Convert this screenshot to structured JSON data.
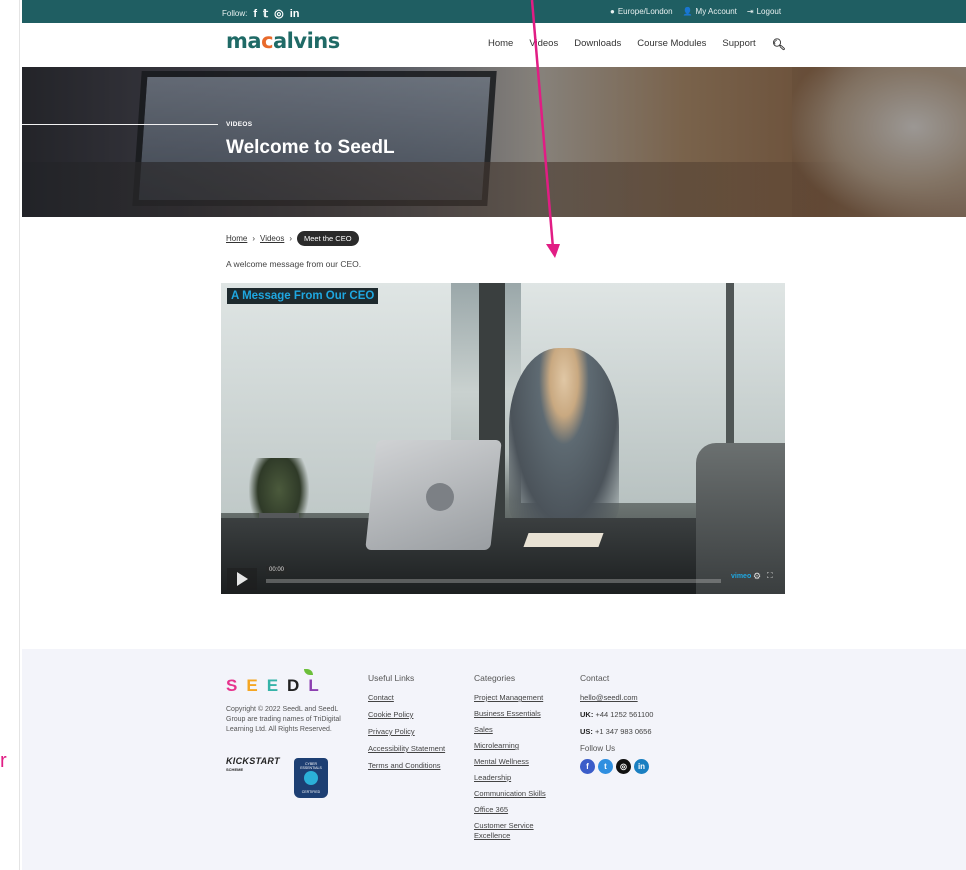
{
  "topbar": {
    "follow_label": "Follow:",
    "social_icons": [
      "facebook-icon",
      "twitter-icon",
      "instagram-icon",
      "linkedin-icon"
    ],
    "timezone": "Europe/London",
    "account": "My Account",
    "logout": "Logout",
    "background": "#1f5e62"
  },
  "brand": {
    "logo_part1": "ma",
    "logo_accent": "c",
    "logo_part2": "alvins"
  },
  "nav": {
    "items": [
      "Home",
      "Videos",
      "Downloads",
      "Course Modules",
      "Support"
    ],
    "search_icon": "search-icon"
  },
  "hero": {
    "kicker": "VIDEOS",
    "title": "Welcome to SeedL"
  },
  "breadcrumb": {
    "home": "Home",
    "videos": "Videos",
    "current": "Meet the CEO"
  },
  "intro": "A welcome message from our CEO.",
  "video": {
    "title": "A Message From Our CEO",
    "time": "00:00",
    "brand": "vimeo"
  },
  "footer": {
    "brand_letters": [
      "S",
      "E",
      "E",
      "D",
      "L"
    ],
    "copyright": "Copyright © 2022 SeedL and SeedL Group are trading names of TriDigital Learning Ltd. All Rights Reserved.",
    "kickstart": "KICKSTART",
    "kickstart_sub": "SCHEME",
    "cyber_top": "CYBER ESSENTIALS",
    "cyber_bottom": "CERTIFIED",
    "useful_links": {
      "heading": "Useful Links",
      "items": [
        "Contact",
        "Cookie Policy",
        "Privacy Policy",
        "Accessibility Statement",
        "Terms and Conditions"
      ]
    },
    "categories": {
      "heading": "Categories",
      "items": [
        "Project Management",
        "Business Essentials",
        "Sales",
        "Microlearning",
        "Mental Wellness",
        "Leadership",
        "Communication Skills",
        "Office 365",
        "Customer Service Excellence"
      ]
    },
    "contact": {
      "heading": "Contact",
      "email": "hello@seedl.com",
      "uk_label": "UK:",
      "uk_phone": "+44 1252 561100",
      "us_label": "US:",
      "us_phone": "+1 347 983 0656",
      "follow_label": "Follow Us",
      "social_icons": [
        "facebook-icon",
        "twitter-icon",
        "instagram-icon",
        "linkedin-icon"
      ]
    }
  },
  "annotation": {
    "color": "#e11d84",
    "side_glyph": "r"
  }
}
